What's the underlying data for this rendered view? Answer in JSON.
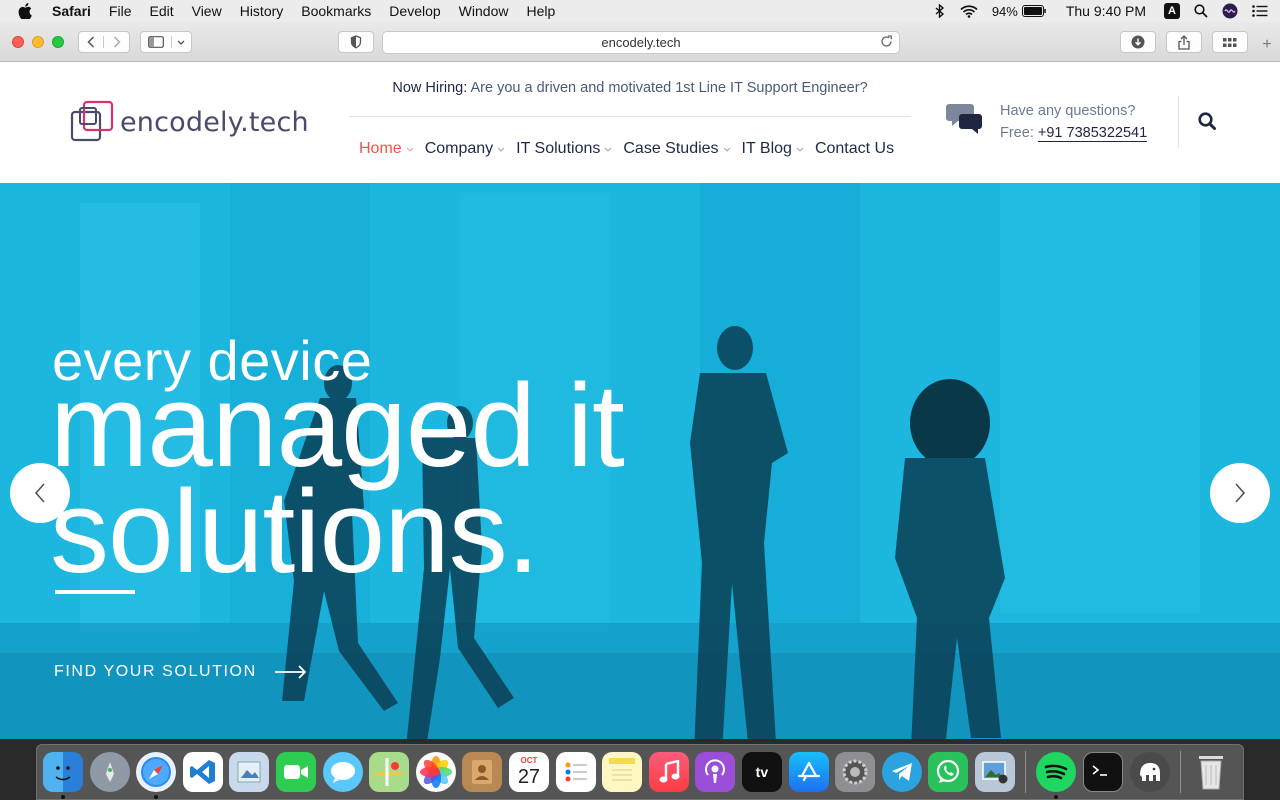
{
  "menubar": {
    "app": "Safari",
    "items": [
      "File",
      "Edit",
      "View",
      "History",
      "Bookmarks",
      "Develop",
      "Window",
      "Help"
    ],
    "battery": "94%",
    "clock": "Thu 9:40 PM",
    "input_source": "A"
  },
  "browser": {
    "url": "encodely.tech"
  },
  "site": {
    "logo_text": "encodely.tech",
    "hiring_label": "Now Hiring:",
    "hiring_text": "Are you a driven and motivated 1st Line IT Support Engineer?",
    "nav": [
      {
        "label": "Home",
        "active": true
      },
      {
        "label": "Company"
      },
      {
        "label": "IT Solutions"
      },
      {
        "label": "Case Studies"
      },
      {
        "label": "IT Blog"
      },
      {
        "label": "Contact Us"
      }
    ],
    "questions_label": "Have any questions?",
    "free_label": "Free:",
    "phone": "+91 7385322541",
    "accent_color": "#ff4d4d",
    "hero_color": "#19b3dc"
  },
  "hero": {
    "line1": "every device",
    "line2a": "managed it",
    "line2b": "solutions.",
    "cta": "FIND YOUR SOLUTION"
  },
  "dock": {
    "calendar_month": "OCT",
    "calendar_day": "27",
    "tv_label": "tv"
  }
}
